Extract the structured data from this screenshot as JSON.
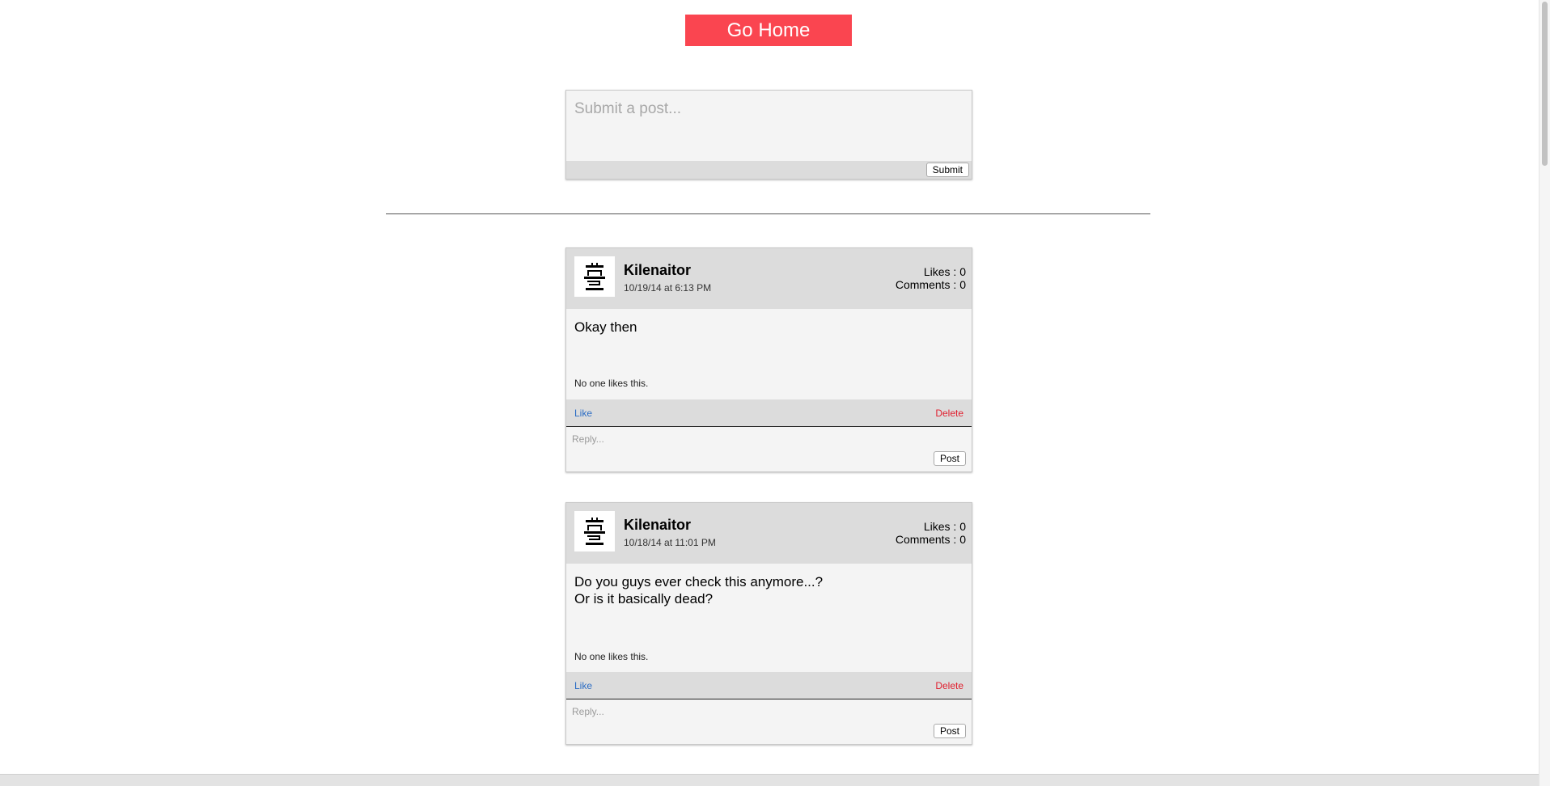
{
  "header": {
    "go_home_label": "Go Home"
  },
  "composer": {
    "placeholder": "Submit a post...",
    "value": "",
    "submit_label": "Submit"
  },
  "posts": [
    {
      "author": "Kilenaitor",
      "timestamp": "10/19/14 at 6:13 PM",
      "likes_label": "Likes :",
      "likes": "0",
      "comments_label": "Comments :",
      "comments": "0",
      "lines": [
        "Okay then"
      ],
      "likes_note": "No one likes this.",
      "like_label": "Like",
      "delete_label": "Delete",
      "reply_placeholder": "Reply...",
      "post_label": "Post"
    },
    {
      "author": "Kilenaitor",
      "timestamp": "10/18/14 at 11:01 PM",
      "likes_label": "Likes :",
      "likes": "0",
      "comments_label": "Comments :",
      "comments": "0",
      "lines": [
        "Do you guys ever check this anymore...?",
        "Or is it basically dead?"
      ],
      "likes_note": "No one likes this.",
      "like_label": "Like",
      "delete_label": "Delete",
      "reply_placeholder": "Reply...",
      "post_label": "Post"
    }
  ],
  "colors": {
    "accent": "#fa4550",
    "link": "#2b6cc4",
    "danger": "#e0202f",
    "panel": "#dcdcdc"
  },
  "icons": {
    "avatar": "castle-tower-icon"
  }
}
